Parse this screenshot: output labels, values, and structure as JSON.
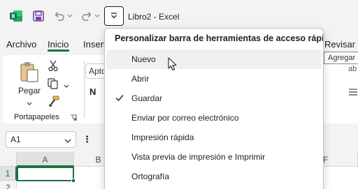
{
  "titlebar": {
    "app_icon": "excel-logo-icon",
    "save_icon": "save-icon",
    "undo_icon": "undo-icon",
    "redo_icon": "redo-icon",
    "customize_icon": "customize-quick-access-icon",
    "document_title": "Libro2  -  Excel"
  },
  "tabs": [
    {
      "label": "Archivo"
    },
    {
      "label": "Inicio",
      "active": true
    },
    {
      "label": "Insert"
    },
    {
      "label": "Revisar"
    }
  ],
  "ribbon": {
    "clipboard": {
      "paste_label": "Pegar",
      "group_label": "Portapapeles"
    },
    "font_name_partial": "Apto",
    "bold_label": "N"
  },
  "formula_bar": {
    "namebox_value": "A1",
    "dots_label": "⋮"
  },
  "grid": {
    "columns": [
      "A",
      "B",
      "F"
    ],
    "rows": [
      "1",
      "2"
    ]
  },
  "menu": {
    "title": "Personalizar barra de herramientas de acceso rápido",
    "items": [
      {
        "label": "Nuevo",
        "checked": false,
        "hover": true
      },
      {
        "label": "Abrir",
        "checked": false
      },
      {
        "label": "Guardar",
        "checked": true
      },
      {
        "label": "Enviar por correo electrónico",
        "checked": false
      },
      {
        "label": "Impresión rápida",
        "checked": false
      },
      {
        "label": "Vista previa de impresión e Imprimir",
        "checked": false
      },
      {
        "label": "Ortografía",
        "checked": false
      }
    ]
  },
  "tooltip": {
    "text": "Agregar a"
  },
  "colors": {
    "accent": "#1a7343",
    "save_purple": "#7b3fa0"
  }
}
